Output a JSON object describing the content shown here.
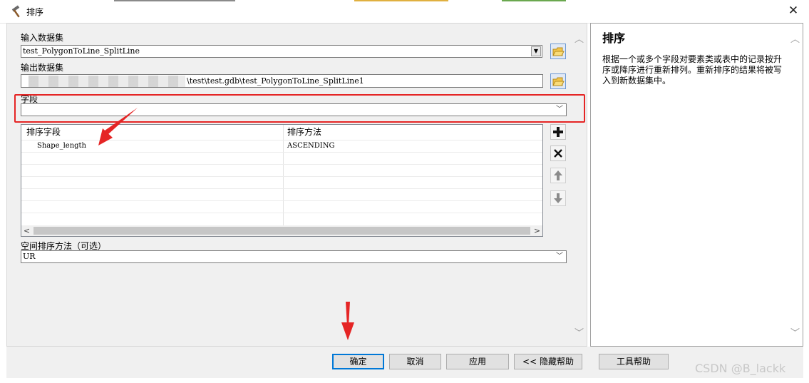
{
  "window": {
    "title": "排序",
    "close_glyph": "✕"
  },
  "input_dataset": {
    "label": "输入数据集",
    "value": "test_PolygonToLine_SplitLine"
  },
  "output_dataset": {
    "label": "输出数据集",
    "value": "\\test\\test.gdb\\test_PolygonToLine_SplitLine1"
  },
  "field": {
    "label": "字段",
    "value": ""
  },
  "sort_table": {
    "headers": [
      "排序字段",
      "排序方法"
    ],
    "rows": [
      {
        "field": "Shape_length",
        "method": "ASCENDING"
      }
    ]
  },
  "spatial_sort": {
    "label": "空间排序方法（可选）",
    "value": "UR"
  },
  "buttons": {
    "ok": "确定",
    "cancel": "取消",
    "apply": "应用",
    "hide_help": "<< 隐藏帮助",
    "tool_help": "工具帮助"
  },
  "help": {
    "title": "排序",
    "body": "根据一个或多个字段对要素类或表中的记录按升序或降序进行重新排列。重新排序的结果将被写入到新数据集中。"
  },
  "icons": {
    "title": "hammer-icon",
    "folder": "open-folder-icon",
    "add": "plus-icon",
    "remove": "x-icon",
    "up": "arrow-up-icon",
    "down": "arrow-down-icon"
  },
  "colors": {
    "highlight": "#e52525",
    "focus": "#0078d7"
  },
  "watermark": "CSDN @B_lackk"
}
